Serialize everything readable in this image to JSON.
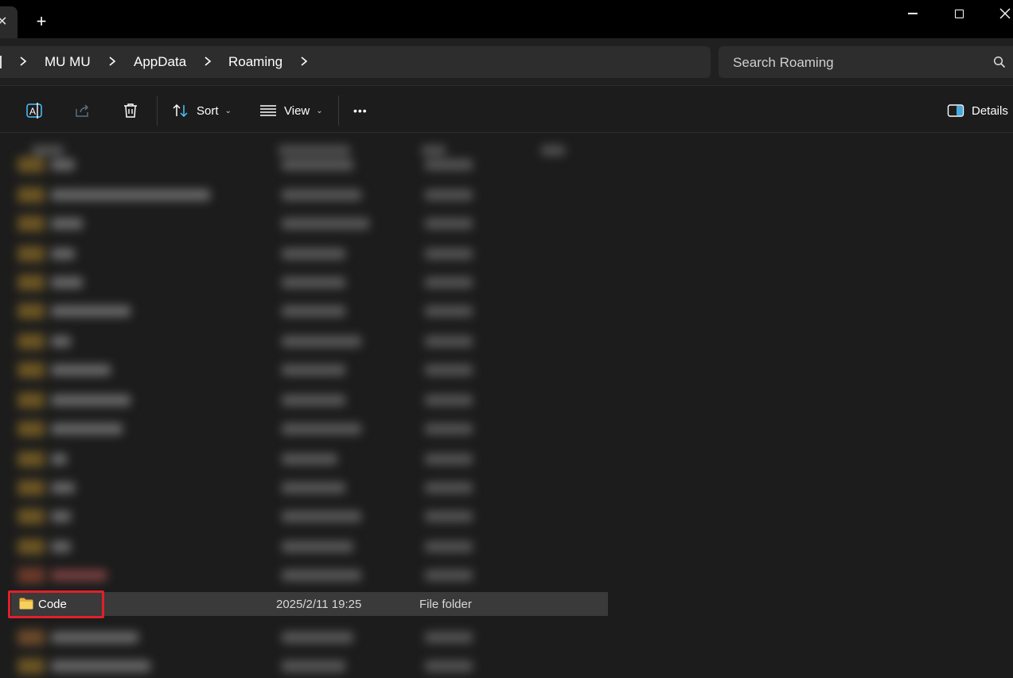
{
  "window": {
    "new_tab_label": "+",
    "tab_close_glyph": "✕",
    "minimize_icon": "minimize-icon",
    "maximize_icon": "maximize-icon",
    "close_icon": "close-icon"
  },
  "breadcrumb": {
    "items": [
      "MU MU",
      "AppData",
      "Roaming"
    ]
  },
  "search": {
    "placeholder": "Search Roaming"
  },
  "toolbar": {
    "sort_label": "Sort",
    "view_label": "View",
    "more_label": "•••",
    "details_label": "Details"
  },
  "file_list": {
    "selected_row": {
      "name": "Code",
      "date_modified": "2025/2/11 19:25",
      "type": "File folder"
    }
  },
  "colors": {
    "highlight": "#e0202a",
    "folder": "#f4c542",
    "accent": "#4cc2ff"
  }
}
